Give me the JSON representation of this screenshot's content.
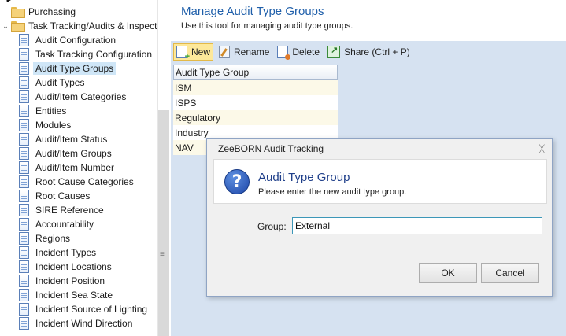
{
  "tree": {
    "parents": [
      {
        "label": "Purchasing",
        "expander": ""
      },
      {
        "label": "Task Tracking/Audits & Inspect",
        "expander": "⌄"
      }
    ],
    "items": [
      {
        "label": "Audit Configuration"
      },
      {
        "label": "Task Tracking Configuration"
      },
      {
        "label": "Audit Type Groups",
        "selected": true
      },
      {
        "label": "Audit Types"
      },
      {
        "label": "Audit/Item Categories"
      },
      {
        "label": "Entities"
      },
      {
        "label": "Modules"
      },
      {
        "label": "Audit/Item Status"
      },
      {
        "label": "Audit/Item Groups"
      },
      {
        "label": "Audit/Item Number"
      },
      {
        "label": "Root Cause Categories"
      },
      {
        "label": "Root Causes"
      },
      {
        "label": "SIRE Reference"
      },
      {
        "label": "Accountability"
      },
      {
        "label": "Regions"
      },
      {
        "label": "Incident Types"
      },
      {
        "label": "Incident Locations"
      },
      {
        "label": "Incident Position"
      },
      {
        "label": "Incident Sea State"
      },
      {
        "label": "Incident Source of Lighting"
      },
      {
        "label": "Incident Wind Direction"
      }
    ],
    "grip": "≡"
  },
  "header": {
    "title": "Manage Audit Type Groups",
    "subtitle": "Use this tool for managing audit type groups."
  },
  "toolbar": {
    "new_label": "New",
    "rename_label": "Rename",
    "delete_label": "Delete",
    "share_label": "Share (Ctrl + P)"
  },
  "grid": {
    "header": "Audit Type Group",
    "rows": [
      "ISM",
      "ISPS",
      "Regulatory",
      "Industry",
      "NAV"
    ]
  },
  "dialog": {
    "title": "ZeeBORN Audit Tracking",
    "close_glyph": "ᚷ",
    "question_glyph": "?",
    "heading": "Audit Type Group",
    "message": "Please enter the new audit type group.",
    "field_label": "Group:",
    "field_value": "External",
    "ok_label": "OK",
    "cancel_label": "Cancel"
  },
  "colors": {
    "accent": "#1f5faa",
    "panel_bg": "#d6e2f1",
    "selection": "#cfe6f7",
    "toolbar_active": "#fde89a"
  }
}
